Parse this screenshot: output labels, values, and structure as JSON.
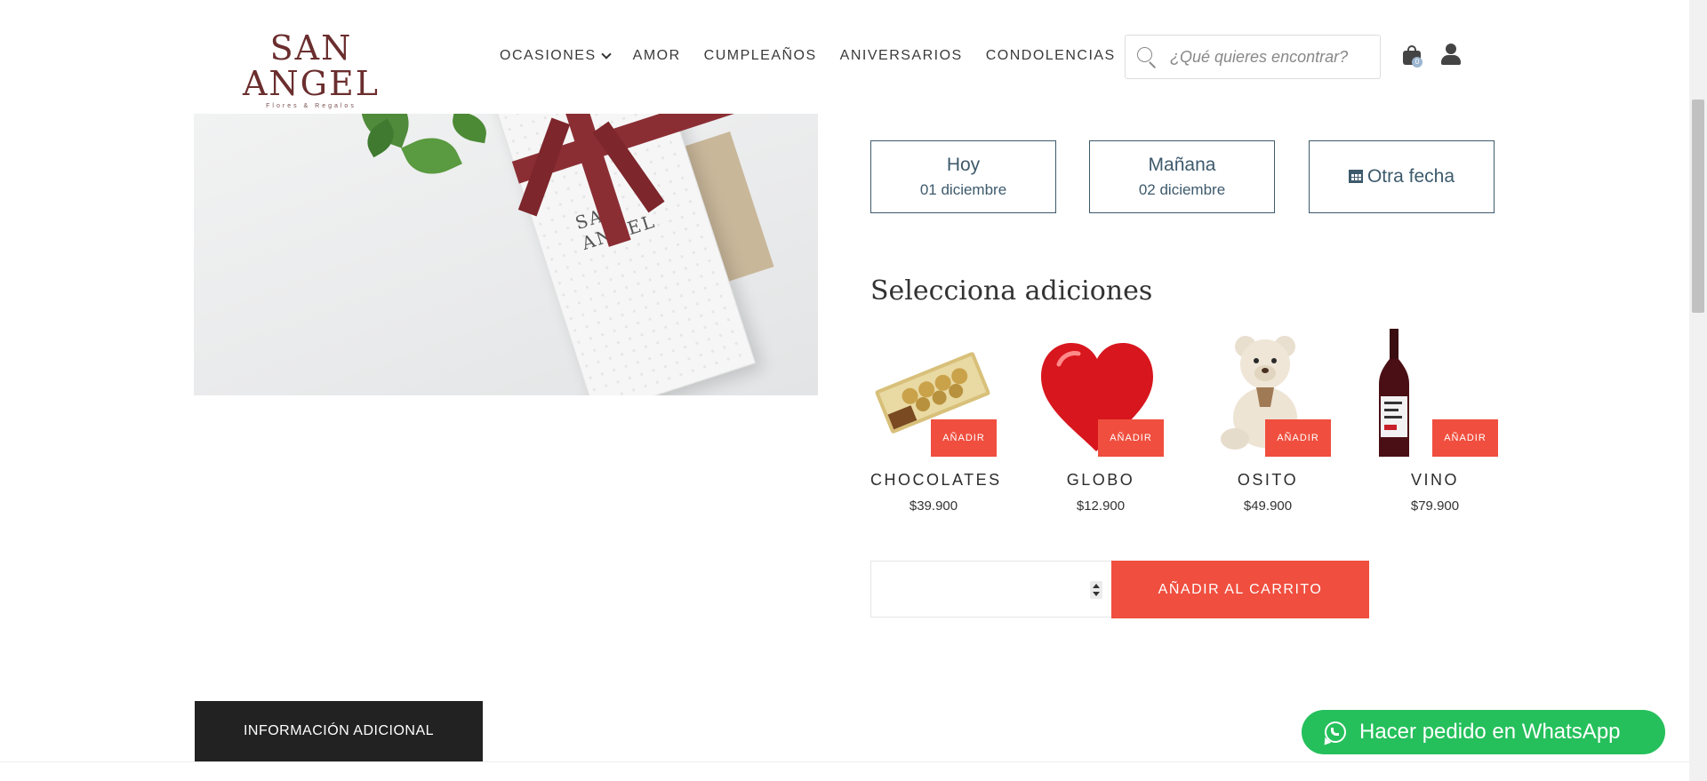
{
  "header": {
    "brand": "SAN ANGEL",
    "tagline": "Flores & Regalos",
    "nav": [
      "OCASIONES",
      "AMOR",
      "CUMPLEAÑOS",
      "ANIVERSARIOS",
      "CONDOLENCIAS"
    ],
    "search_placeholder": "¿Qué quieres encontrar?",
    "cart_count": "0"
  },
  "product": {
    "box_brand": "SAN ANGEL"
  },
  "delivery_dates": [
    {
      "label": "Hoy",
      "date": "01 diciembre"
    },
    {
      "label": "Mañana",
      "date": "02 diciembre"
    },
    {
      "label": "Otra fecha",
      "icon": "calendar-icon"
    }
  ],
  "addons": {
    "title": "Selecciona adiciones",
    "add_label": "AÑADIR",
    "items": [
      {
        "name": "CHOCOLATES",
        "price": "$39.900"
      },
      {
        "name": "GLOBO",
        "price": "$12.900"
      },
      {
        "name": "OSITO",
        "price": "$49.900"
      },
      {
        "name": "VINO",
        "price": "$79.900"
      }
    ]
  },
  "cart": {
    "quantity": "",
    "add_to_cart_label": "AÑADIR AL CARRITO"
  },
  "tabs": {
    "info_label": "INFORMACIÓN ADICIONAL"
  },
  "whatsapp": {
    "label": "Hacer pedido en WhatsApp"
  },
  "colors": {
    "accent": "#f04e3e",
    "brand": "#6b2e2e",
    "date_border": "#3d5a6c",
    "whatsapp": "#25c05b"
  }
}
